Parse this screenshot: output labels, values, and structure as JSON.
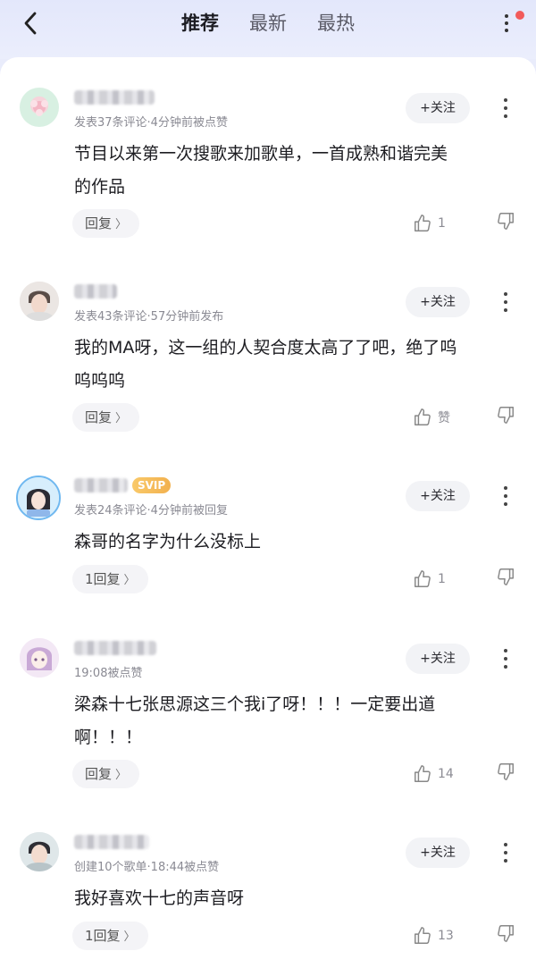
{
  "header": {
    "tabs": [
      {
        "label": "推荐",
        "active": true
      },
      {
        "label": "最新",
        "active": false
      },
      {
        "label": "最热",
        "active": false
      }
    ],
    "icons": {
      "back": "chevron-left-icon",
      "more": "more-vertical-icon",
      "notification": "red-dot-badge"
    }
  },
  "colors": {
    "accent_red": "#f25a5a",
    "svip_gold": "#f2b14e",
    "text_primary": "#1d1d22",
    "text_meta": "#8a8a93"
  },
  "comments": [
    {
      "meta": "发表37条评论·4分钟前被点赞",
      "text_lines": [
        "节目以来第一次搜歌来加歌单，一首成熟和谐完美",
        "的作品"
      ],
      "follow_label": "+关注",
      "reply_label": "回复",
      "like_count": "1",
      "svip": ""
    },
    {
      "meta": "发表43条评论·57分钟前发布",
      "text_lines": [
        "我的MA呀，这一组的人契合度太高了了吧，绝了呜",
        "呜呜呜"
      ],
      "follow_label": "+关注",
      "reply_label": "回复",
      "like_count": "赞",
      "svip": ""
    },
    {
      "meta": "发表24条评论·4分钟前被回复",
      "text_lines": [
        "森哥的名字为什么没标上"
      ],
      "follow_label": "+关注",
      "reply_label": "1回复",
      "like_count": "1",
      "svip": "SVIP"
    },
    {
      "meta": "19:08被点赞",
      "text_lines": [
        "梁森十七张思源这三个我i了呀！！！一定要出道",
        "啊！！！"
      ],
      "follow_label": "+关注",
      "reply_label": "回复",
      "like_count": "14",
      "svip": ""
    },
    {
      "meta": "创建10个歌单·18:44被点赞",
      "text_lines": [
        "我好喜欢十七的声音呀"
      ],
      "follow_label": "+关注",
      "reply_label": "1回复",
      "like_count": "13",
      "svip": ""
    }
  ]
}
